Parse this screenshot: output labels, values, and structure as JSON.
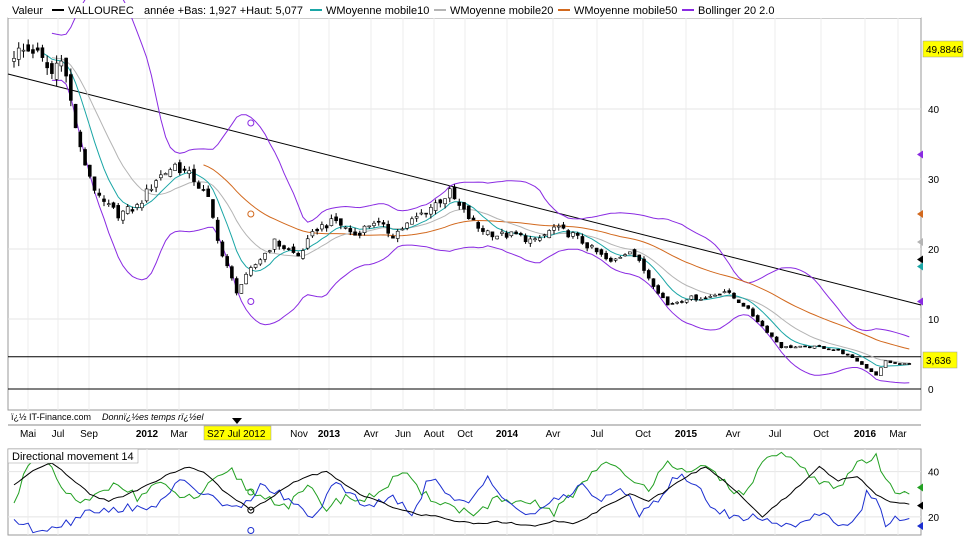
{
  "legend": {
    "symbol_label": "Valeur",
    "symbol_name": "VALLOUREC",
    "stats": "année +Bas: 1,927 +Haut: 5,077",
    "items": [
      {
        "label": "WMoyenne mobile10",
        "color": "#1aa6a6"
      },
      {
        "label": "WMoyenne mobile20",
        "color": "#b4b4b4"
      },
      {
        "label": "WMoyenne mobile50",
        "color": "#d2691e"
      },
      {
        "label": "Bollinger 20 2.0",
        "color": "#8a2be2"
      }
    ]
  },
  "price_labels": {
    "high": "49,8846",
    "last": "3,636"
  },
  "x_axis": {
    "labels": [
      "Mai",
      "Jul",
      "Sep",
      "2012",
      "Mar",
      "Nov",
      "2013",
      "Avr",
      "Jun",
      "Aout",
      "Oct",
      "2014",
      "Avr",
      "Jul",
      "Oct",
      "2015",
      "Avr",
      "Jul",
      "Oct",
      "2016",
      "Mar"
    ],
    "cursor_label": "S27 Jul 2012"
  },
  "footer": {
    "copyright": "ï¿½ IT-Finance.com",
    "data_note": "Donnï¿½es temps rï¿½el"
  },
  "indicator": {
    "title": "Directional movement 14",
    "ticks": [
      "40",
      "20"
    ]
  },
  "chart_data": [
    {
      "type": "candlestick",
      "title": "VALLOUREC",
      "ylim": [
        -3,
        53
      ],
      "yticks": [
        0,
        10,
        20,
        30,
        40
      ],
      "grid": true,
      "price_key_points": [
        [
          0,
          48
        ],
        [
          4,
          48.5
        ],
        [
          8,
          45
        ],
        [
          10,
          48
        ],
        [
          14,
          34
        ],
        [
          18,
          27
        ],
        [
          22,
          25
        ],
        [
          26,
          26
        ],
        [
          30,
          30
        ],
        [
          34,
          32
        ],
        [
          38,
          30
        ],
        [
          41,
          27
        ],
        [
          44,
          19
        ],
        [
          47,
          14
        ],
        [
          50,
          17
        ],
        [
          55,
          21
        ],
        [
          60,
          19
        ],
        [
          64,
          23
        ],
        [
          68,
          24
        ],
        [
          72,
          22
        ],
        [
          76,
          24
        ],
        [
          80,
          22
        ],
        [
          84,
          24
        ],
        [
          88,
          26
        ],
        [
          92,
          28
        ],
        [
          94,
          26
        ],
        [
          98,
          23
        ],
        [
          102,
          22
        ],
        [
          106,
          22
        ],
        [
          110,
          21
        ],
        [
          114,
          23
        ],
        [
          118,
          22
        ],
        [
          122,
          20
        ],
        [
          126,
          18
        ],
        [
          130,
          20
        ],
        [
          134,
          16
        ],
        [
          138,
          12
        ],
        [
          142,
          13
        ],
        [
          146,
          13
        ],
        [
          150,
          14
        ],
        [
          154,
          12
        ],
        [
          158,
          9
        ],
        [
          162,
          6
        ],
        [
          166,
          6
        ],
        [
          170,
          6
        ],
        [
          174,
          5.5
        ],
        [
          178,
          4
        ],
        [
          180,
          3
        ],
        [
          182,
          2
        ],
        [
          184,
          4
        ],
        [
          186,
          3.6
        ]
      ],
      "resistance_line": [
        [
          0,
          45
        ],
        [
          190,
          12
        ]
      ],
      "horizontal_lines": [
        4.6,
        0
      ],
      "bollinger_markers": [
        [
          50,
          38
        ],
        [
          50,
          12.5
        ]
      ],
      "ma50_markers": [
        [
          50,
          25
        ]
      ],
      "right_markers": [
        {
          "value": 33.5,
          "color": "#8a2be2"
        },
        {
          "value": 25,
          "color": "#d2691e"
        },
        {
          "value": 21,
          "color": "#b4b4b4"
        },
        {
          "value": 18.5,
          "color": "#000000"
        },
        {
          "value": 17.5,
          "color": "#1aa6a6"
        },
        {
          "value": 12.5,
          "color": "#8a2be2"
        }
      ]
    },
    {
      "type": "line",
      "title": "Directional movement 14",
      "ylim": [
        12,
        50
      ],
      "yticks": [
        40,
        20
      ],
      "series": [
        {
          "color": "#22a022",
          "key_points": [
            [
              0,
              25
            ],
            [
              2,
              40
            ],
            [
              6,
              47
            ],
            [
              10,
              33
            ],
            [
              14,
              25
            ],
            [
              18,
              30
            ],
            [
              22,
              36
            ],
            [
              26,
              28
            ],
            [
              30,
              35
            ],
            [
              34,
              30
            ],
            [
              38,
              28
            ],
            [
              42,
              35
            ],
            [
              46,
              40
            ],
            [
              50,
              31
            ],
            [
              54,
              28
            ],
            [
              58,
              25
            ],
            [
              62,
              33
            ],
            [
              66,
              24
            ],
            [
              70,
              29
            ],
            [
              74,
              27
            ],
            [
              78,
              33
            ],
            [
              82,
              40
            ],
            [
              86,
              30
            ],
            [
              90,
              27
            ],
            [
              94,
              23
            ],
            [
              98,
              22
            ],
            [
              102,
              28
            ],
            [
              106,
              25
            ],
            [
              110,
              26
            ],
            [
              114,
              22
            ],
            [
              118,
              30
            ],
            [
              122,
              40
            ],
            [
              126,
              45
            ],
            [
              130,
              35
            ],
            [
              134,
              33
            ],
            [
              138,
              46
            ],
            [
              142,
              38
            ],
            [
              146,
              42
            ],
            [
              150,
              36
            ],
            [
              154,
              28
            ],
            [
              158,
              45
            ],
            [
              162,
              47
            ],
            [
              166,
              42
            ],
            [
              170,
              36
            ],
            [
              174,
              32
            ],
            [
              178,
              44
            ],
            [
              182,
              46
            ],
            [
              184,
              36
            ],
            [
              186,
              32
            ]
          ]
        },
        {
          "color": "#1c2fd0",
          "key_points": [
            [
              0,
              19
            ],
            [
              4,
              14
            ],
            [
              8,
              16
            ],
            [
              12,
              18
            ],
            [
              16,
              24
            ],
            [
              20,
              22
            ],
            [
              24,
              25
            ],
            [
              28,
              22
            ],
            [
              32,
              30
            ],
            [
              36,
              36
            ],
            [
              40,
              30
            ],
            [
              44,
              26
            ],
            [
              48,
              23
            ],
            [
              52,
              34
            ],
            [
              56,
              30
            ],
            [
              60,
              24
            ],
            [
              64,
              20
            ],
            [
              68,
              36
            ],
            [
              72,
              28
            ],
            [
              76,
              25
            ],
            [
              80,
              28
            ],
            [
              84,
              22
            ],
            [
              88,
              38
            ],
            [
              92,
              28
            ],
            [
              96,
              25
            ],
            [
              100,
              38
            ],
            [
              104,
              28
            ],
            [
              108,
              20
            ],
            [
              112,
              25
            ],
            [
              116,
              28
            ],
            [
              120,
              35
            ],
            [
              124,
              26
            ],
            [
              128,
              33
            ],
            [
              132,
              22
            ],
            [
              136,
              28
            ],
            [
              140,
              38
            ],
            [
              144,
              34
            ],
            [
              148,
              23
            ],
            [
              152,
              20
            ],
            [
              156,
              20
            ],
            [
              160,
              18
            ],
            [
              164,
              16
            ],
            [
              168,
              20
            ],
            [
              172,
              20
            ],
            [
              176,
              16
            ],
            [
              178,
              20
            ],
            [
              180,
              30
            ],
            [
              182,
              28
            ],
            [
              184,
              17
            ],
            [
              186,
              20
            ]
          ]
        },
        {
          "color": "#000000",
          "key_points": [
            [
              0,
              34
            ],
            [
              4,
              40
            ],
            [
              8,
              44
            ],
            [
              12,
              37
            ],
            [
              16,
              30
            ],
            [
              20,
              27
            ],
            [
              24,
              30
            ],
            [
              28,
              34
            ],
            [
              32,
              38
            ],
            [
              36,
              42
            ],
            [
              40,
              40
            ],
            [
              44,
              32
            ],
            [
              48,
              26
            ],
            [
              50,
              23
            ],
            [
              54,
              28
            ],
            [
              58,
              34
            ],
            [
              62,
              38
            ],
            [
              66,
              40
            ],
            [
              70,
              34
            ],
            [
              74,
              29
            ],
            [
              78,
              26
            ],
            [
              82,
              23
            ],
            [
              86,
              21
            ],
            [
              90,
              20
            ],
            [
              94,
              18
            ],
            [
              98,
              17
            ],
            [
              102,
              18
            ],
            [
              106,
              17
            ],
            [
              110,
              16
            ],
            [
              114,
              18
            ],
            [
              118,
              17
            ],
            [
              122,
              21
            ],
            [
              126,
              26
            ],
            [
              130,
              30
            ],
            [
              134,
              27
            ],
            [
              138,
              32
            ],
            [
              142,
              38
            ],
            [
              146,
              42
            ],
            [
              150,
              36
            ],
            [
              154,
              28
            ],
            [
              158,
              20
            ],
            [
              162,
              27
            ],
            [
              166,
              34
            ],
            [
              170,
              42
            ],
            [
              174,
              36
            ],
            [
              178,
              38
            ],
            [
              182,
              30
            ],
            [
              186,
              26
            ]
          ]
        }
      ]
    }
  ]
}
